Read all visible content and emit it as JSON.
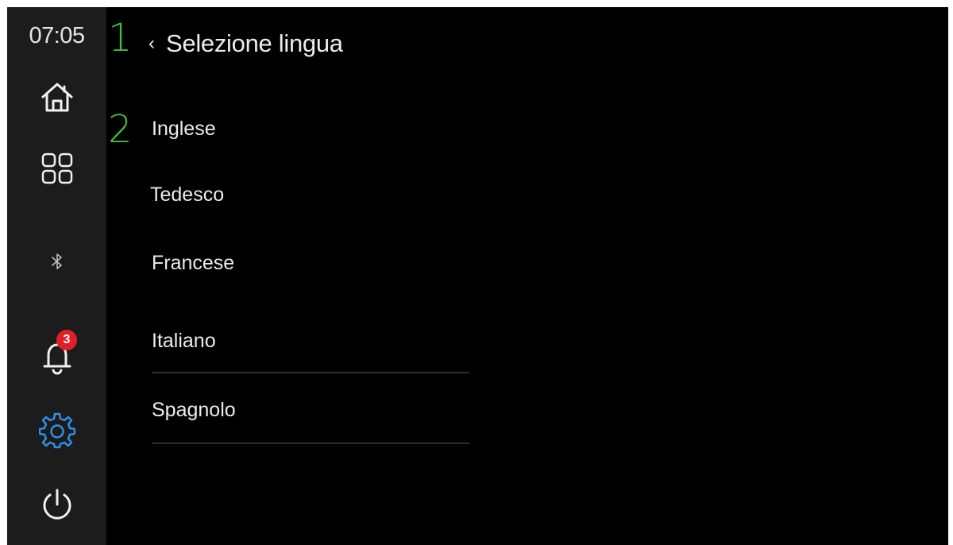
{
  "status": {
    "time": "07:05"
  },
  "sidebar": {
    "items": [
      {
        "name": "home",
        "icon": "home-icon"
      },
      {
        "name": "apps",
        "icon": "grid-icon"
      },
      {
        "name": "bluetooth",
        "icon": "bluetooth-icon"
      },
      {
        "name": "notifications",
        "icon": "bell-icon",
        "badge": "3"
      },
      {
        "name": "settings",
        "icon": "gear-icon",
        "active": true
      },
      {
        "name": "power",
        "icon": "power-icon"
      }
    ],
    "active_color": "#2f8fe8",
    "badge_color": "#e21f26"
  },
  "annotations": {
    "marker_1": "1",
    "marker_2": "2",
    "color": "#3fbf3f"
  },
  "header": {
    "back_icon": "chevron-left-icon",
    "title": "Selezione lingua"
  },
  "languages": [
    {
      "label": "Inglese"
    },
    {
      "label": "Tedesco"
    },
    {
      "label": "Francese"
    },
    {
      "label": "Italiano"
    },
    {
      "label": "Spagnolo"
    }
  ]
}
